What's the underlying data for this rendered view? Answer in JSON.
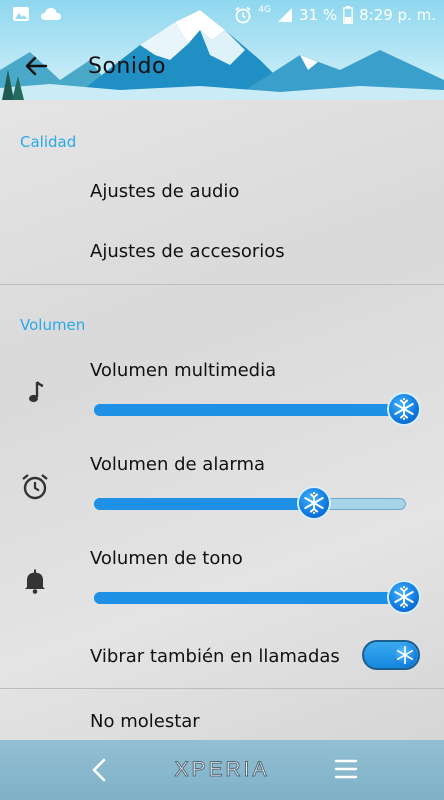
{
  "status_bar": {
    "network": "4G",
    "battery_percent": "31 %",
    "time": "8:29 p. m."
  },
  "header": {
    "title": "Sonido"
  },
  "sections": {
    "quality": {
      "title": "Calidad",
      "items": [
        "Ajustes de audio",
        "Ajustes de accesorios"
      ]
    },
    "volume": {
      "title": "Volumen",
      "media": {
        "label": "Volumen multimedia",
        "level": 1.0
      },
      "alarm": {
        "label": "Volumen de alarma",
        "level": 0.71
      },
      "ringtone": {
        "label": "Volumen de tono",
        "level": 1.0
      },
      "vibrate": {
        "label": "Vibrar también en llamadas",
        "enabled": true
      }
    },
    "do_not_disturb": {
      "label": "No molestar"
    }
  },
  "navbar": {
    "brand": "XPERIA"
  },
  "colors": {
    "accent": "#2aa9e8",
    "slider_fill": "#1e90e6",
    "slider_track": "#a8d4ea",
    "navbar": "#87b8cc"
  }
}
